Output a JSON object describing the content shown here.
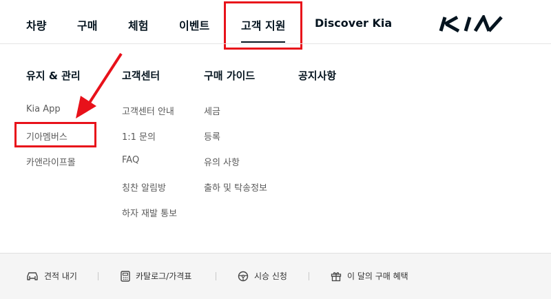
{
  "nav": {
    "items": [
      {
        "label": "차량"
      },
      {
        "label": "구매"
      },
      {
        "label": "체험"
      },
      {
        "label": "이벤트"
      },
      {
        "label": "고객 지원"
      },
      {
        "label": "Discover Kia"
      }
    ],
    "logo_text": "KIA"
  },
  "menu": {
    "columns": [
      {
        "title": "유지 & 관리",
        "links": [
          "Kia App",
          "기아멤버스",
          "카앤라이프몰"
        ]
      },
      {
        "title": "고객센터",
        "links": [
          "고객센터 안내",
          "1:1 문의",
          "FAQ",
          "칭찬 알림방",
          "하자 재발 통보"
        ]
      },
      {
        "title": "구매 가이드",
        "links": [
          "세금",
          "등록",
          "유의 사항",
          "출하 및 탁송정보"
        ]
      },
      {
        "title": "공지사항",
        "links": []
      }
    ]
  },
  "footer": {
    "items": [
      {
        "label": "견적 내기",
        "icon": "car-icon"
      },
      {
        "label": "카탈로그/가격표",
        "icon": "calculator-icon"
      },
      {
        "label": "시승 신청",
        "icon": "steering-wheel-icon"
      },
      {
        "label": "이 달의 구매 혜택",
        "icon": "gift-icon"
      }
    ]
  },
  "colors": {
    "annotation": "#e8111a",
    "text": "#05141f",
    "muted": "#5a5a5a",
    "footer_bg": "#f5f5f5"
  }
}
